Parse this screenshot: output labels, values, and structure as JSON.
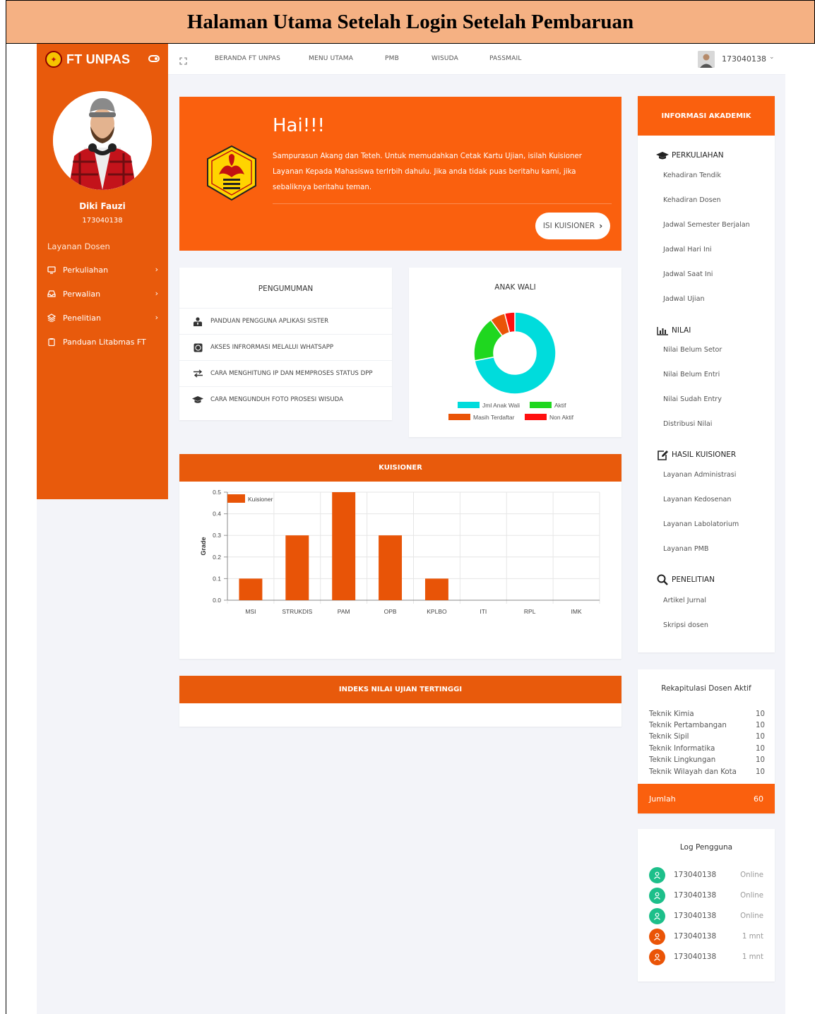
{
  "caption": "Halaman Utama Setelah Login Setelah Pembaruan",
  "brand": {
    "name": "FT UNPAS"
  },
  "user": {
    "name": "Diki Fauzi",
    "id": "173040138"
  },
  "sidebar": {
    "heading": "Layanan Dosen",
    "items": [
      {
        "label": "Perkuliahan",
        "icon": "monitor-icon"
      },
      {
        "label": "Perwalian",
        "icon": "inbox-icon"
      },
      {
        "label": "Penelitian",
        "icon": "layers-icon"
      },
      {
        "label": "Panduan Litabmas FT",
        "icon": "clipboard-icon"
      }
    ]
  },
  "topnav": {
    "links": [
      "BERANDA FT UNPAS",
      "MENU UTAMA",
      "PMB",
      "WISUDA",
      "PASSMAIL"
    ],
    "user": "173040138"
  },
  "hero": {
    "title": "Hai!!!",
    "text": "Sampurasun Akang dan Teteh. Untuk memudahkan Cetak Kartu Ujian, isilah Kuisioner Layanan Kepada Mahasiswa terlrbih dahulu. Jika anda tidak puas beritahu kami, jika sebaliknya beritahu teman.",
    "button": "ISI KUISIONER"
  },
  "pengumuman": {
    "title": "PENGUMUMAN",
    "items": [
      {
        "label": "PANDUAN PENGGUNA APLIKASI SISTER",
        "icon": "user-tie-icon"
      },
      {
        "label": "AKSES INFRORMASI MELALUI WHATSAPP",
        "icon": "whatsapp-icon"
      },
      {
        "label": "CARA MENGHITUNG IP DAN MEMPROSES STATUS DPP",
        "icon": "exchange-icon"
      },
      {
        "label": "CARA MENGUNDUH FOTO PROSESI WISUDA",
        "icon": "graduation-cap-icon"
      }
    ]
  },
  "chart_data": [
    {
      "type": "pie",
      "title": "ANAK WALI",
      "categories": [
        "Jml Anak Wali",
        "Aktif",
        "Masih Terdaftar",
        "Non Aktif"
      ],
      "values": [
        72,
        18,
        6,
        4
      ],
      "colors": [
        "#00dcdc",
        "#1fd71f",
        "#ea5407",
        "#ff1010"
      ],
      "legend": "bottom"
    },
    {
      "type": "bar",
      "title": "KUISIONER",
      "categories": [
        "MSI",
        "STRUKDIS",
        "PAM",
        "OPB",
        "KPLBO",
        "ITI",
        "RPL",
        "IMK"
      ],
      "series": [
        {
          "name": "Kuisioner",
          "values": [
            0.1,
            0.3,
            0.5,
            0.3,
            0.1,
            0,
            0,
            0
          ]
        }
      ],
      "ylabel": "Grade",
      "ylim": [
        0,
        0.5
      ],
      "yticks": [
        "0.0",
        "0.1",
        "0.2",
        "0.3",
        "0.4",
        "0.5"
      ],
      "color": "#e85407",
      "grid": true,
      "legend": "top-left"
    }
  ],
  "indeks": {
    "title": "INDEKS NILAI UJIAN TERTINGGI"
  },
  "info": {
    "title": "INFORMASI AKADEMIK",
    "sections": [
      {
        "title": "PERKULIAHAN",
        "icon": "graduation-cap-icon",
        "items": [
          "Kehadiran Tendik",
          "Kehadiran Dosen",
          "Jadwal Semester Berjalan",
          "Jadwal Hari Ini",
          "Jadwal Saat Ini",
          "Jadwal Ujian"
        ]
      },
      {
        "title": "NILAI",
        "icon": "bar-chart-icon",
        "items": [
          "Nilai Belum Setor",
          "Nilai Belum Entri",
          "Nilai Sudah Entry",
          "Distribusi Nilai"
        ]
      },
      {
        "title": "HASIL KUISIONER",
        "icon": "edit-icon",
        "items": [
          "Layanan Administrasi",
          "Layanan Kedosenan",
          "Layanan Labolatorium",
          "Layanan PMB"
        ]
      },
      {
        "title": "PENELITIAN",
        "icon": "search-icon",
        "items": [
          "Artikel Jurnal",
          "Skripsi dosen"
        ]
      }
    ]
  },
  "rekap": {
    "title": "Rekapitulasi Dosen Aktif",
    "rows": [
      {
        "name": "Teknik Kimia",
        "count": "10"
      },
      {
        "name": "Teknik Pertambangan",
        "count": "10"
      },
      {
        "name": "Teknik Sipil",
        "count": "10"
      },
      {
        "name": "Teknik Informatika",
        "count": "10"
      },
      {
        "name": "Teknik Lingkungan",
        "count": "10"
      },
      {
        "name": "Teknik Wilayah dan Kota",
        "count": "10"
      }
    ],
    "total_label": "Jumlah",
    "total": "60"
  },
  "log": {
    "title": "Log Pengguna",
    "rows": [
      {
        "id": "173040138",
        "status": "Online",
        "color": "#1dbf8a"
      },
      {
        "id": "173040138",
        "status": "Online",
        "color": "#1dbf8a"
      },
      {
        "id": "173040138",
        "status": "Online",
        "color": "#1dbf8a"
      },
      {
        "id": "173040138",
        "status": "1 mnt",
        "color": "#ea5407"
      },
      {
        "id": "173040138",
        "status": "1 mnt",
        "color": "#ea5407"
      }
    ]
  }
}
